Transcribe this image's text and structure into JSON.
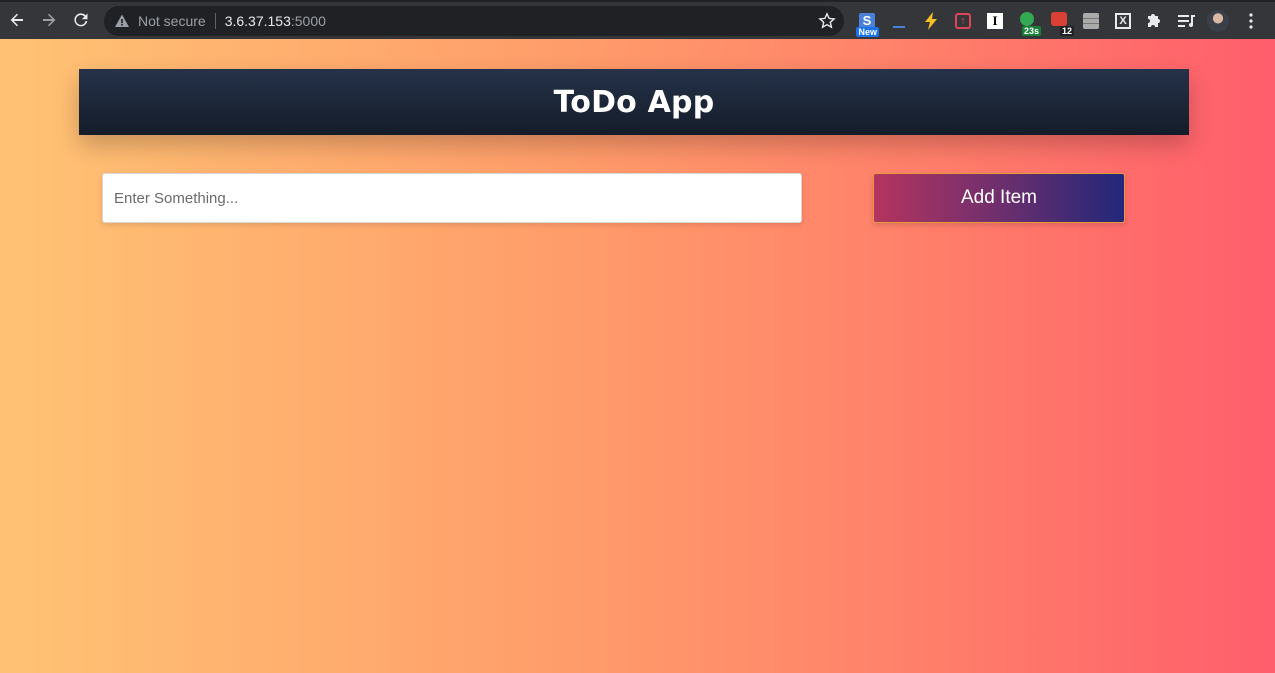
{
  "browser": {
    "security_label": "Not secure",
    "url_host": "3.6.37.153",
    "url_port": ":5000",
    "extensions": [
      {
        "icon": "s-new-extension-icon",
        "badge": "New",
        "badge_color": "#1a73e8"
      },
      {
        "icon": "underscore-extension-icon",
        "badge": ""
      },
      {
        "icon": "lightning-extension-icon",
        "badge": ""
      },
      {
        "icon": "upload-extension-icon",
        "badge": ""
      },
      {
        "icon": "i-extension-icon",
        "badge": ""
      },
      {
        "icon": "timer-extension-icon",
        "badge": "23s",
        "badge_color": "#188038"
      },
      {
        "icon": "todoist-extension-icon",
        "badge": "12",
        "badge_color": "#202124"
      },
      {
        "icon": "stack-extension-icon",
        "badge": ""
      },
      {
        "icon": "x-box-extension-icon",
        "badge": ""
      }
    ]
  },
  "app": {
    "title": "ToDo App",
    "input_placeholder": "Enter Something...",
    "add_button_label": "Add Item"
  },
  "colors": {
    "header_bg": "#1c2636",
    "gradient_start": "#ffc374",
    "gradient_end": "#ff5e6c",
    "button_start": "#b5345f",
    "button_end": "#22277a"
  }
}
